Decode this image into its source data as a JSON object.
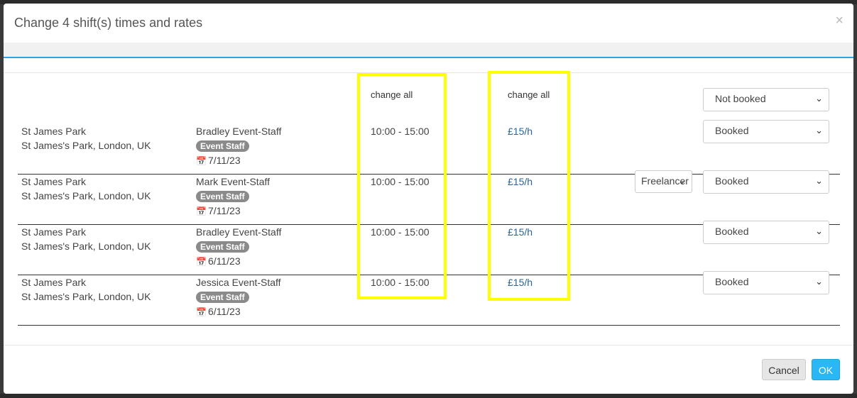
{
  "modal": {
    "title": "Change 4 shift(s) times and rates",
    "close_glyph": "×"
  },
  "header": {
    "change_all_time": "change all",
    "change_all_rate": "change all",
    "status_all": "Not booked"
  },
  "rows": [
    {
      "location": "St James Park",
      "address": "St James's Park, London, UK",
      "staff": "Bradley Event-Staff",
      "role": "Event Staff",
      "date": "7/11/23",
      "time": "10:00 - 15:00",
      "rate": "£15/h",
      "type": "",
      "status": "Booked"
    },
    {
      "location": "St James Park",
      "address": "St James's Park, London, UK",
      "staff": "Mark Event-Staff",
      "role": "Event Staff",
      "date": "7/11/23",
      "time": "10:00 - 15:00",
      "rate": "£15/h",
      "type": "Freelancer",
      "status": "Booked"
    },
    {
      "location": "St James Park",
      "address": "St James's Park, London, UK",
      "staff": "Bradley Event-Staff",
      "role": "Event Staff",
      "date": "6/11/23",
      "time": "10:00 - 15:00",
      "rate": "£15/h",
      "type": "",
      "status": "Booked"
    },
    {
      "location": "St James Park",
      "address": "St James's Park, London, UK",
      "staff": "Jessica Event-Staff",
      "role": "Event Staff",
      "date": "6/11/23",
      "time": "10:00 - 15:00",
      "rate": "£15/h",
      "type": "",
      "status": "Booked"
    }
  ],
  "footer": {
    "cancel_label": "Cancel",
    "ok_label": "OK"
  },
  "icons": {
    "calendar": "calendar-icon",
    "caret": "chevron-down-icon"
  },
  "colors": {
    "highlight": "#ffff00",
    "accent": "#2ea3e6",
    "ok_button": "#2ab7f5",
    "rate_link": "#2a6496",
    "badge": "#8a8a8a"
  }
}
